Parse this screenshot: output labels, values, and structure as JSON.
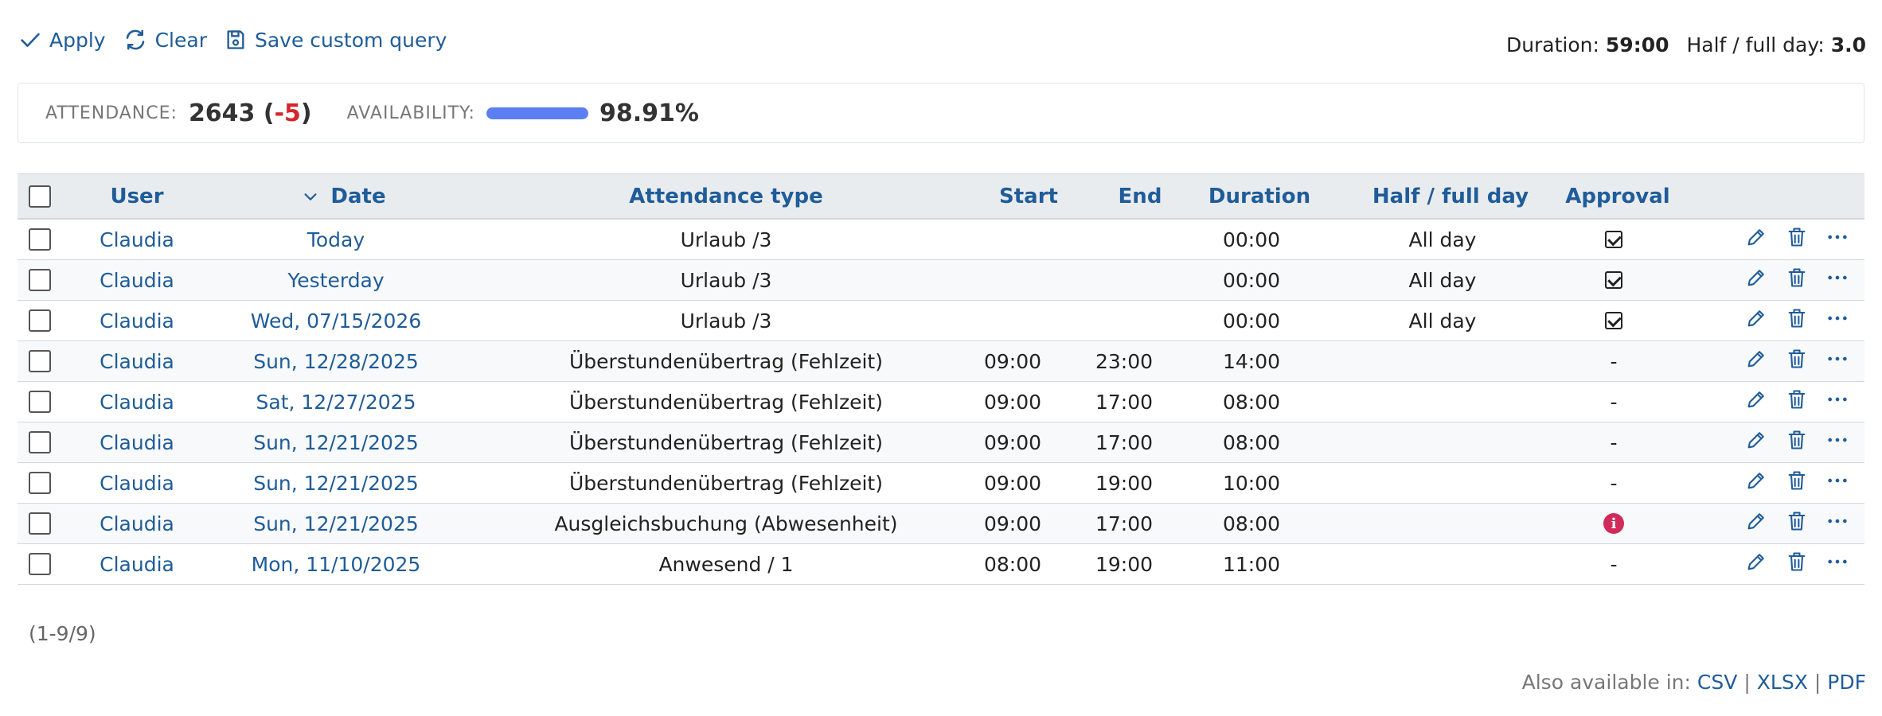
{
  "toolbar": {
    "apply_label": "Apply",
    "clear_label": "Clear",
    "save_label": "Save custom query"
  },
  "summary": {
    "duration_label": "Duration:",
    "duration_value": "59:00",
    "halfday_label": "Half / full day:",
    "halfday_value": "3.0"
  },
  "stats": {
    "attendance_label": "ATTENDANCE:",
    "attendance_value": "2643",
    "attendance_open": " (",
    "attendance_delta": "-5",
    "attendance_close": ")",
    "availability_label": "AVAILABILITY:",
    "availability_value": "98.91%",
    "availability_fraction": 0.9891
  },
  "columns": {
    "user": "User",
    "date": "Date",
    "type": "Attendance type",
    "start": "Start",
    "end": "End",
    "duration": "Duration",
    "half": "Half / full day",
    "approval": "Approval"
  },
  "rows": [
    {
      "user": "Claudia",
      "date": "Today",
      "type": "Urlaub /3",
      "start": "",
      "end": "",
      "duration": "00:00",
      "half": "All day",
      "approval": "check"
    },
    {
      "user": "Claudia",
      "date": "Yesterday",
      "type": "Urlaub /3",
      "start": "",
      "end": "",
      "duration": "00:00",
      "half": "All day",
      "approval": "check"
    },
    {
      "user": "Claudia",
      "date": "Wed, 07/15/2026",
      "type": "Urlaub /3",
      "start": "",
      "end": "",
      "duration": "00:00",
      "half": "All day",
      "approval": "check"
    },
    {
      "user": "Claudia",
      "date": "Sun, 12/28/2025",
      "type": "Überstundenübertrag (Fehlzeit)",
      "start": "09:00",
      "end": "23:00",
      "duration": "14:00",
      "half": "",
      "approval": "-"
    },
    {
      "user": "Claudia",
      "date": "Sat, 12/27/2025",
      "type": "Überstundenübertrag (Fehlzeit)",
      "start": "09:00",
      "end": "17:00",
      "duration": "08:00",
      "half": "",
      "approval": "-"
    },
    {
      "user": "Claudia",
      "date": "Sun, 12/21/2025",
      "type": "Überstundenübertrag (Fehlzeit)",
      "start": "09:00",
      "end": "17:00",
      "duration": "08:00",
      "half": "",
      "approval": "-"
    },
    {
      "user": "Claudia",
      "date": "Sun, 12/21/2025",
      "type": "Überstundenübertrag (Fehlzeit)",
      "start": "09:00",
      "end": "19:00",
      "duration": "10:00",
      "half": "",
      "approval": "-"
    },
    {
      "user": "Claudia",
      "date": "Sun, 12/21/2025",
      "type": "Ausgleichsbuchung (Abwesenheit)",
      "start": "09:00",
      "end": "17:00",
      "duration": "08:00",
      "half": "",
      "approval": "info"
    },
    {
      "user": "Claudia",
      "date": "Mon, 11/10/2025",
      "type": "Anwesend / 1",
      "start": "08:00",
      "end": "19:00",
      "duration": "11:00",
      "half": "",
      "approval": "-"
    }
  ],
  "pager": "(1-9/9)",
  "exports": {
    "label": "Also available in:",
    "csv": "CSV",
    "xlsx": "XLSX",
    "pdf": "PDF"
  },
  "icons": {
    "apply": "check-icon",
    "clear": "refresh-icon",
    "save": "floppy-icon",
    "sort": "chevron-down-icon",
    "edit": "pencil-icon",
    "delete": "trash-icon",
    "more": "ellipsis-icon",
    "info": "info-icon"
  },
  "colors": {
    "link": "#1f5c99",
    "negative": "#d4262c",
    "bar": "#5b7ff0",
    "info": "#d12b5b"
  }
}
